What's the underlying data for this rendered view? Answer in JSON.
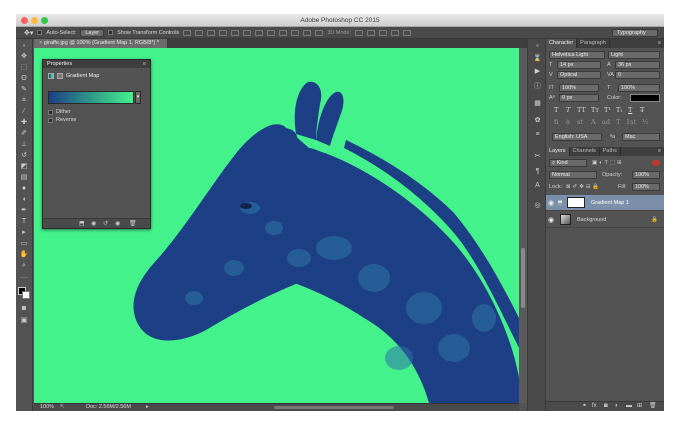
{
  "window": {
    "title": "Adobe Photoshop CC 2015",
    "traffic_lights": [
      "#fc605b",
      "#fdbc40",
      "#34c84a"
    ]
  },
  "options_bar": {
    "auto_select_label": "Auto-Select:",
    "auto_select_value": "Layer",
    "transform_label": "Show Transform Controls",
    "mode_label": "3D Mode:",
    "workspace": "Typography"
  },
  "document": {
    "tab_label": "giraffe.jpg @ 100% (Gradient Map 1, RGB/8*) *",
    "canvas_color": "#44f28c",
    "ink_color": "#1c3f86",
    "zoom": "100%",
    "doc_size": "Doc: 2.56M/2.56M"
  },
  "properties": {
    "panel_title": "Properties",
    "adjustment": "Gradient Map",
    "options": [
      "Dither",
      "Reverse"
    ]
  },
  "character": {
    "tabs": [
      "Character",
      "Paragraph"
    ],
    "font_family": "Helvetica Light",
    "font_style": "Light",
    "size": "14 px",
    "leading": "36 px",
    "kerning": "Optical",
    "tracking": "0",
    "vscale": "100%",
    "hscale": "100%",
    "baseline": "0 px",
    "color_label": "Color:",
    "style_buttons": [
      "T",
      "T",
      "TT",
      "Tт",
      "T¹",
      "T₁",
      "T",
      "T̶"
    ],
    "ot_buttons": [
      "fi",
      "ꝺ",
      "st",
      "A",
      "ad",
      "T",
      "1st",
      "½"
    ],
    "language": "English: USA",
    "aa_prefix": "ªa",
    "antialias": "Mac"
  },
  "layers": {
    "tabs": [
      "Layers",
      "Channels",
      "Paths"
    ],
    "filter": "Kind",
    "blend_mode": "Normal",
    "opacity_label": "Opacity:",
    "opacity": "100%",
    "lock_label": "Lock:",
    "fill_label": "Fill:",
    "fill": "100%",
    "items": [
      {
        "name": "Gradient Map 1",
        "selected": true
      },
      {
        "name": "Background",
        "selected": false
      }
    ]
  }
}
